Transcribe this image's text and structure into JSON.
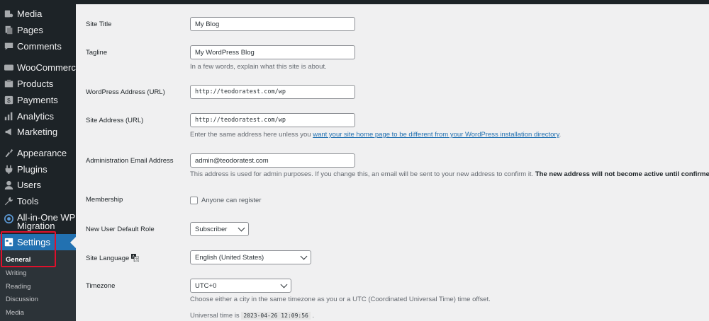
{
  "sidebar": {
    "items": [
      {
        "label": "Media",
        "icon": "media-icon"
      },
      {
        "label": "Pages",
        "icon": "pages-icon"
      },
      {
        "label": "Comments",
        "icon": "comments-icon"
      },
      {
        "label": "WooCommerce",
        "icon": "woocommerce-icon"
      },
      {
        "label": "Products",
        "icon": "products-icon"
      },
      {
        "label": "Payments",
        "icon": "payments-icon"
      },
      {
        "label": "Analytics",
        "icon": "analytics-icon"
      },
      {
        "label": "Marketing",
        "icon": "marketing-icon"
      },
      {
        "label": "Appearance",
        "icon": "appearance-icon"
      },
      {
        "label": "Plugins",
        "icon": "plugins-icon"
      },
      {
        "label": "Users",
        "icon": "users-icon"
      },
      {
        "label": "Tools",
        "icon": "tools-icon"
      },
      {
        "label_line1": "All-in-One WP",
        "label_line2": "Migration",
        "icon": "migration-icon"
      },
      {
        "label": "Settings",
        "icon": "settings-icon"
      }
    ],
    "submenu": [
      "General",
      "Writing",
      "Reading",
      "Discussion",
      "Media"
    ],
    "active_color": "#2271b1",
    "highlight_color": "#e0102b"
  },
  "form": {
    "site_title": {
      "label": "Site Title",
      "value": "My Blog"
    },
    "tagline": {
      "label": "Tagline",
      "value": "My WordPress Blog",
      "desc": "In a few words, explain what this site is about."
    },
    "wp_address": {
      "label": "WordPress Address (URL)",
      "value": "http://teodoratest.com/wp"
    },
    "site_address": {
      "label": "Site Address (URL)",
      "value": "http://teodoratest.com/wp",
      "desc_pre": "Enter the same address here unless you ",
      "desc_link": "want your site home page to be different from your WordPress installation directory",
      "desc_post": "."
    },
    "admin_email": {
      "label": "Administration Email Address",
      "value": "admin@teodoratest.com",
      "desc_pre": "This address is used for admin purposes. If you change this, an email will be sent to your new address to confirm it. ",
      "desc_bold": "The new address will not become active until confirmed."
    },
    "membership": {
      "label": "Membership",
      "checkbox_label": "Anyone can register"
    },
    "default_role": {
      "label": "New User Default Role",
      "value": "Subscriber"
    },
    "site_language": {
      "label": "Site Language",
      "value": "English (United States)"
    },
    "timezone": {
      "label": "Timezone",
      "value": "UTC+0",
      "desc": "Choose either a city in the same timezone as you or a UTC (Coordinated Universal Time) time offset.",
      "universal_pre": "Universal time is ",
      "universal_value": "2023-04-26 12:09:56",
      "universal_post": " ."
    }
  }
}
